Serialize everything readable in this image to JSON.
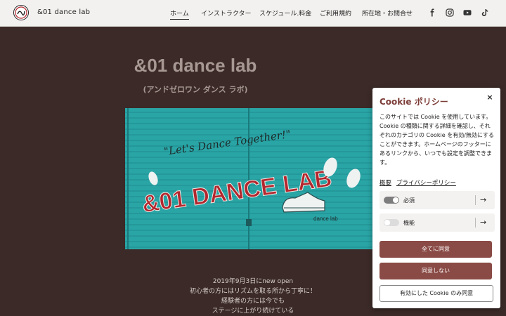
{
  "header": {
    "brand": "&01 dance lab",
    "nav": [
      {
        "label": "ホーム",
        "active": true
      },
      {
        "label": "インストラクター"
      },
      {
        "label": "スケジュール.料金"
      },
      {
        "label": "ご利用規約"
      },
      {
        "label": "所在地・お問合せ"
      }
    ],
    "social_icons": [
      "facebook-icon",
      "instagram-icon",
      "youtube-icon",
      "tiktok-icon"
    ]
  },
  "hero": {
    "title": "&01 dance lab",
    "subtitle": "(アンドゼロワン ダンス ラボ)",
    "shutter_text": {
      "script": "\"Let's Dance Together!\"",
      "main": "&01 DANCE LAB",
      "small": "dance lab"
    },
    "description": [
      "2019年9月3日にnew open",
      "初心者の方にはリズムを取る所から丁寧に！",
      "経験者の方には今でも",
      "ステージに上がり続けている"
    ]
  },
  "cookie": {
    "title": "Cookie ポリシー",
    "close_glyph": "×",
    "body": "このサイトでは Cookie を使用しています。Cookie の種類に関する詳細を確認し、それぞれのカテゴリの Cookie を有効/無効にすることができます。ホームページのフッターにあるリンクから、いつでも設定を調整できます。",
    "links": [
      "概要",
      "プライバシーポリシー"
    ],
    "toggles": [
      {
        "label": "必須",
        "on": true
      },
      {
        "label": "機能",
        "on": false
      }
    ],
    "arrow_glyph": "→",
    "buttons": {
      "accept_all": "全てに同意",
      "decline": "同意しない",
      "accept_selected": "有効にした Cookie のみ同意"
    }
  },
  "colors": {
    "page_bg": "#3b2a28",
    "accent": "#8a4a45",
    "shutter": "#2aa5a6",
    "lettering": "#b3262e"
  }
}
